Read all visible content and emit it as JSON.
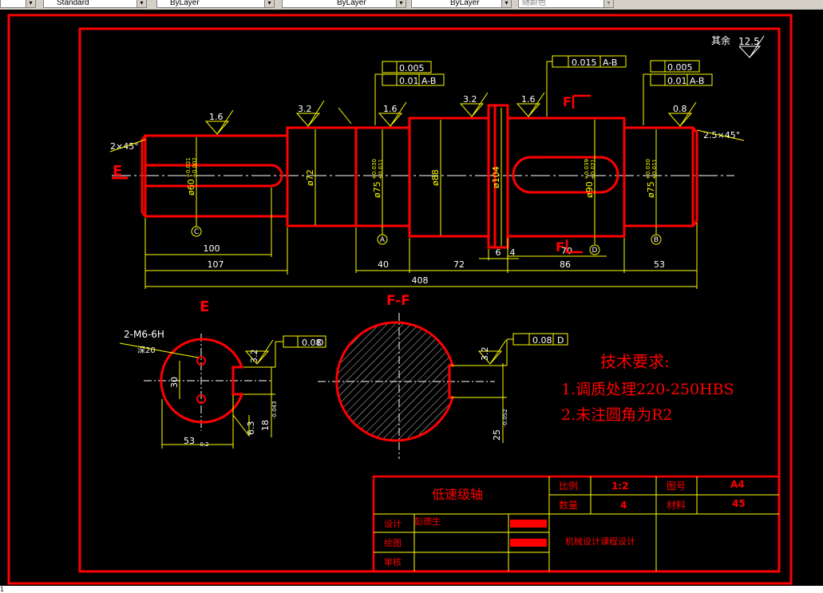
{
  "toolbar": {
    "text_style": "Standard",
    "layer_color": "ByLayer",
    "linetype": "ByLayer",
    "lineweight": "ByLayer",
    "plot_style": "随颜色"
  },
  "drawing": {
    "roughness_note": "其余",
    "roughness_main": "12.5",
    "views": {
      "section_label_left": "E",
      "section_label_right": "E",
      "section_view_e": "E",
      "section_view_f": "F-F",
      "cut_f_top": "F",
      "cut_f_bottom": "F"
    },
    "dimensions": {
      "d1": "100",
      "d2": "107",
      "d3": "40",
      "d4": "72",
      "d5": "6",
      "d6": "4",
      "d7": "70",
      "d8": "86",
      "d9": "53",
      "total": "408",
      "chamfer_left": "2×45°",
      "chamfer_right": "2.5×45°",
      "dia_60": "ø60",
      "dia_60_tol_up": "+0.021",
      "dia_60_tol_lo": "+0.002",
      "dia_72": "ø72",
      "dia_75a": "ø75",
      "dia_75_tol_up": "+0.030",
      "dia_75_tol_lo": "+0.011",
      "dia_88": "ø88",
      "dia_104": "ø104",
      "dia_90": "ø90",
      "dia_90_tol_up": "+0.039",
      "dia_90_tol_lo": "+0.021",
      "dia_75b": "ø75",
      "thread": "2-M6-6H",
      "depth": "深20",
      "e_30": "30",
      "e_18": "18",
      "e_18_tol": "-0.043",
      "e_53": "53",
      "e_53_tol": "-0.2",
      "f_25": "25",
      "f_25_tol": "-0.052"
    },
    "roughness": {
      "r1": "1.6",
      "r2": "3.2",
      "r3": "1.6",
      "r4": "3.2",
      "r5": "1.6",
      "r6": "0.8",
      "r7": "3.2",
      "r8": "6.3",
      "r9": "3.2"
    },
    "tolerance_frames": {
      "f1_val": "0.005",
      "f2_val": "0.01",
      "f2_ref": "A-B",
      "f3_val": "0.015",
      "f3_ref": "A-B",
      "f4_val": "0.005",
      "f5_val": "0.01",
      "f5_ref": "A-B",
      "f6_val": "0.08",
      "f6_ref": "D",
      "f7_val": "0.08",
      "f7_ref": "D"
    },
    "datums": {
      "a": "A",
      "b": "B",
      "c": "C",
      "d": "D"
    },
    "tech_requirements": {
      "title": "技术要求:",
      "line1": "1.调质处理220-250HBS",
      "line2": "2.未注圆角为R2"
    },
    "title_block": {
      "part_name": "低速级轴",
      "scale_label": "比例",
      "scale_value": "1:2",
      "drawing_no_label": "图号",
      "drawing_no_value": "A4",
      "qty_label": "数量",
      "qty_value": "4",
      "material_label": "材料",
      "material_value": "45",
      "design_label": "设计",
      "designer": "彭德生",
      "drawn_label": "绘图",
      "check_label": "审核",
      "course": "机械设计课程设计"
    }
  },
  "colors": {
    "border": "#ff0000",
    "outline": "#ff0000",
    "dimension": "#ffff00",
    "centerline": "#ffffff",
    "text_tech": "#ff0000",
    "hatch": "#ffffff"
  },
  "status": {
    "text": "1"
  }
}
